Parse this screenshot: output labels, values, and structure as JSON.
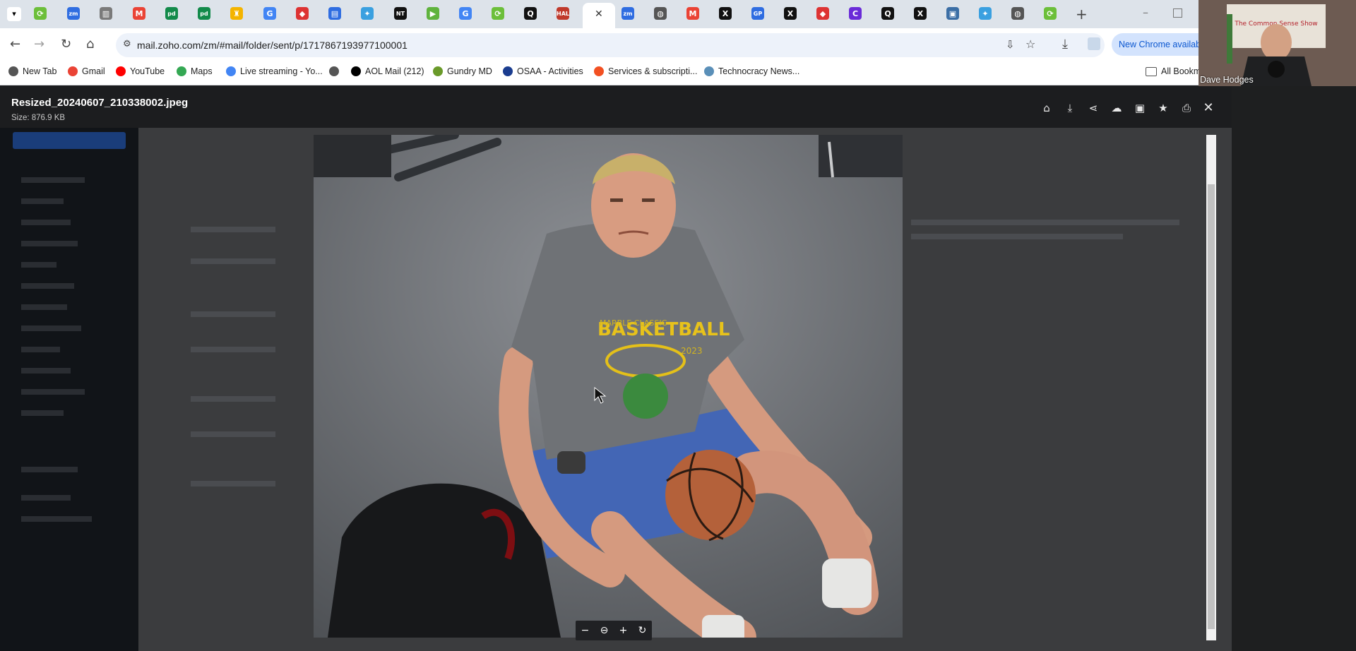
{
  "browser": {
    "url": "mail.zoho.com/zm/#mail/folder/sent/p/1717867193977100001",
    "update_button": "New Chrome availab",
    "bookmarks": [
      {
        "label": "New Tab",
        "icon": "globe-icon",
        "color": "#555555"
      },
      {
        "label": "Gmail",
        "icon": "gmail-icon",
        "color": "#ea4335"
      },
      {
        "label": "YouTube",
        "icon": "youtube-icon",
        "color": "#ff0000"
      },
      {
        "label": "Maps",
        "icon": "maps-icon",
        "color": "#34a853"
      },
      {
        "label": "Live streaming - Yo...",
        "icon": "google-icon",
        "color": "#4285f4"
      },
      {
        "label": "",
        "icon": "globe-icon",
        "color": "#555555"
      },
      {
        "label": "AOL Mail (212)",
        "icon": "aol-icon",
        "color": "#000000"
      },
      {
        "label": "Gundry MD",
        "icon": "gundry-icon",
        "color": "#6a9a2a"
      },
      {
        "label": "OSAA - Activities",
        "icon": "osaa-icon",
        "color": "#1a3c8f"
      },
      {
        "label": "Services & subscripti...",
        "icon": "microsoft-icon",
        "color": "#f25022"
      },
      {
        "label": "Technocracy News...",
        "icon": "technocracy-icon",
        "color": "#5a8fb8"
      }
    ],
    "all_bookmarks": "All Bookm"
  },
  "viewer": {
    "file_name": "Resized_20240607_210338002.jpeg",
    "file_size": "Size: 876.9 KB",
    "actions": [
      "tag-icon",
      "download-icon",
      "share-icon",
      "upload-cloud-icon",
      "attach-image-icon",
      "star-icon",
      "print-icon",
      "close-icon"
    ],
    "shirt_text": "BASKETBALL",
    "shirt_year": "2023",
    "shirt_top": "MARBLE CLASSIC"
  },
  "webcam": {
    "name": "Dave Hodges",
    "banner": "The Common Sense Show"
  },
  "colors": {
    "tabstrip": "#dde3ea",
    "viewer_bg": "#3b3c3e",
    "header_bg": "#1c1d1f"
  }
}
